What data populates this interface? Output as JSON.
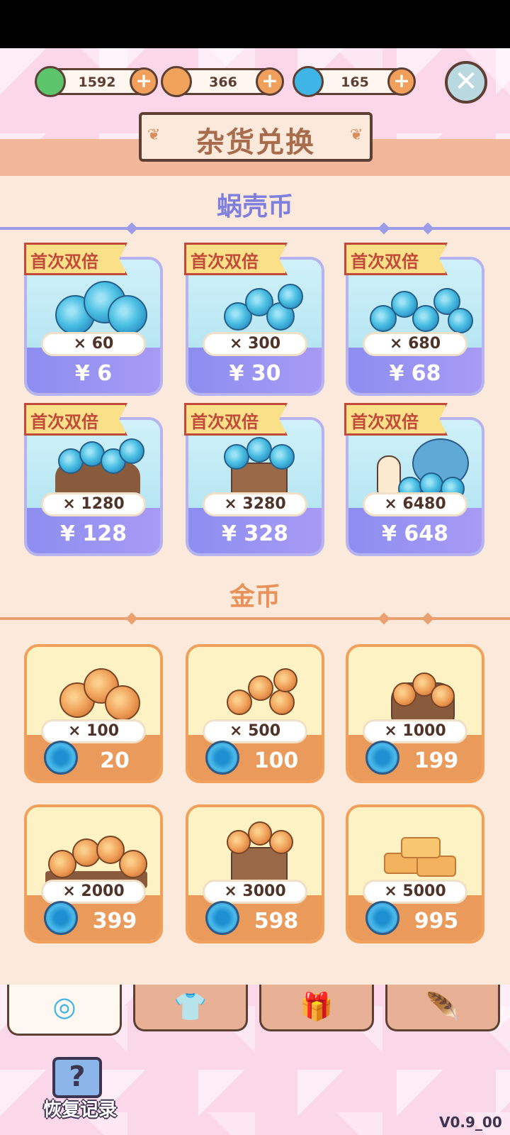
{
  "header": {
    "currencies": [
      {
        "name": "clover",
        "value": "1592",
        "color": "#5cc46a"
      },
      {
        "name": "gold-coin",
        "value": "366",
        "color": "#f0a15a"
      },
      {
        "name": "snail-shell-coin",
        "value": "165",
        "color": "#3fb4e6"
      }
    ],
    "plus_label": "+",
    "close_label": "✕",
    "title": "杂货兑换"
  },
  "snail_section": {
    "title": "蜗壳币",
    "badge": "首次双倍",
    "items": [
      {
        "qty": "× 60",
        "price": "¥ 6"
      },
      {
        "qty": "× 300",
        "price": "¥ 30"
      },
      {
        "qty": "× 680",
        "price": "¥ 68"
      },
      {
        "qty": "× 1280",
        "price": "¥ 128"
      },
      {
        "qty": "× 3280",
        "price": "¥ 328"
      },
      {
        "qty": "× 6480",
        "price": "¥ 648"
      }
    ]
  },
  "gold_section": {
    "title": "金币",
    "items": [
      {
        "qty": "× 100",
        "price": "20"
      },
      {
        "qty": "× 500",
        "price": "100"
      },
      {
        "qty": "× 1000",
        "price": "199"
      },
      {
        "qty": "× 2000",
        "price": "399"
      },
      {
        "qty": "× 3000",
        "price": "598"
      },
      {
        "qty": "× 5000",
        "price": "995"
      }
    ]
  },
  "tabs": [
    {
      "icon": "snail-shell-icon",
      "glyph": "◎"
    },
    {
      "icon": "shirt-icon",
      "glyph": "👕"
    },
    {
      "icon": "gift-icon",
      "glyph": "🎁"
    },
    {
      "icon": "feather-icon",
      "glyph": "🪶"
    }
  ],
  "restore": {
    "label": "恢复记录",
    "glyph": "?"
  },
  "version": "V0.9_00"
}
